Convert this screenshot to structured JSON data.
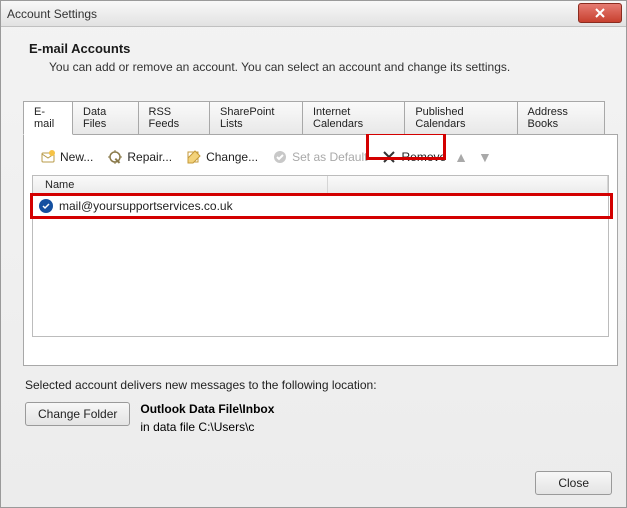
{
  "window": {
    "title": "Account Settings"
  },
  "header": {
    "title": "E-mail Accounts",
    "description": "You can add or remove an account. You can select an account and change its settings."
  },
  "tabs": [
    {
      "label": "E-mail",
      "active": true
    },
    {
      "label": "Data Files"
    },
    {
      "label": "RSS Feeds"
    },
    {
      "label": "SharePoint Lists"
    },
    {
      "label": "Internet Calendars"
    },
    {
      "label": "Published Calendars"
    },
    {
      "label": "Address Books"
    }
  ],
  "toolbar": {
    "new": "New...",
    "repair": "Repair...",
    "change": "Change...",
    "set_default": "Set as Default",
    "remove": "Remove"
  },
  "list": {
    "columns": {
      "c1": "Name",
      "c2": ""
    },
    "rows": [
      {
        "name": "mail@yoursupportservices.co.uk"
      }
    ]
  },
  "delivery": {
    "label": "Selected account delivers new messages to the following location:",
    "change_folder": "Change Folder",
    "location_title": "Outlook Data File\\Inbox",
    "location_path": "in data file C:\\Users\\c"
  },
  "buttons": {
    "close": "Close"
  }
}
